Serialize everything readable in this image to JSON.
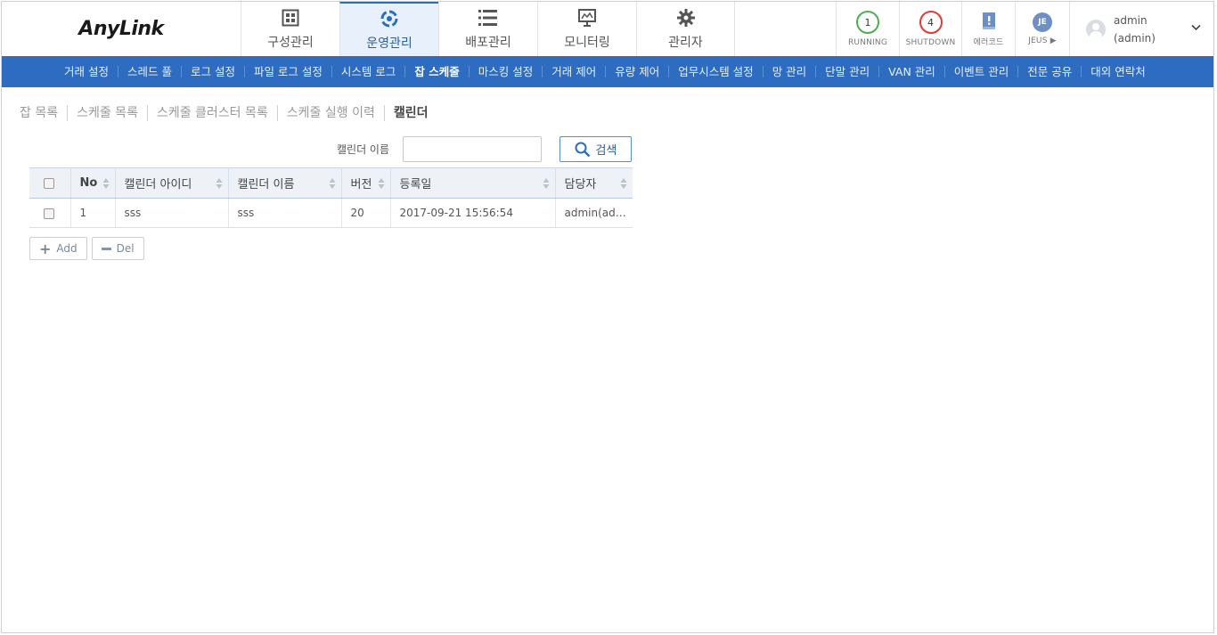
{
  "app": {
    "logo": "AnyLink"
  },
  "main_nav": [
    {
      "label": "구성관리",
      "icon": "grid-icon"
    },
    {
      "label": "운영관리",
      "icon": "target-icon",
      "active": true
    },
    {
      "label": "배포관리",
      "icon": "list-icon"
    },
    {
      "label": "모니터링",
      "icon": "monitor-icon"
    },
    {
      "label": "관리자",
      "icon": "gear-icon"
    }
  ],
  "status": {
    "running": {
      "count": "1",
      "label": "RUNNING",
      "color": "#4caf50"
    },
    "shutdown": {
      "count": "4",
      "label": "SHUTDOWN",
      "color": "#e53935"
    },
    "errorcode": {
      "label": "에러코드"
    },
    "jeus": {
      "badge": "JE",
      "label": "JEUS ▶"
    }
  },
  "user": {
    "name": "admin",
    "id": "(admin)"
  },
  "sub_nav": [
    "거래 설정",
    "스레드 풀",
    "로그 설정",
    "파일 로그 설정",
    "시스템 로그",
    "잡 스케줄",
    "마스킹 설정",
    "거래 제어",
    "유량 제어",
    "업무시스템 설정",
    "망 관리",
    "단말 관리",
    "VAN 관리",
    "이벤트 관리",
    "전문 공유",
    "대외 연락처"
  ],
  "sub_nav_active": 5,
  "tabs": [
    "잡 목록",
    "스케줄 목록",
    "스케줄 클러스터 목록",
    "스케줄 실행 이력",
    "캘린더"
  ],
  "tabs_active": 4,
  "search": {
    "label": "캘린더 이름",
    "value": "",
    "button": "검색"
  },
  "grid": {
    "columns": [
      "No",
      "캘린더 아이디",
      "캘린더 이름",
      "버전",
      "등록일",
      "담당자"
    ],
    "rows": [
      {
        "no": "1",
        "calendar_id": "sss",
        "calendar_name": "sss",
        "version": "20",
        "registered": "2017-09-21 15:56:54",
        "owner": "admin(admi..."
      }
    ]
  },
  "actions": {
    "add": "Add",
    "del": "Del"
  },
  "colors": {
    "accent": "#2d6cc0",
    "active_tab_bg": "#e8f1fb"
  }
}
